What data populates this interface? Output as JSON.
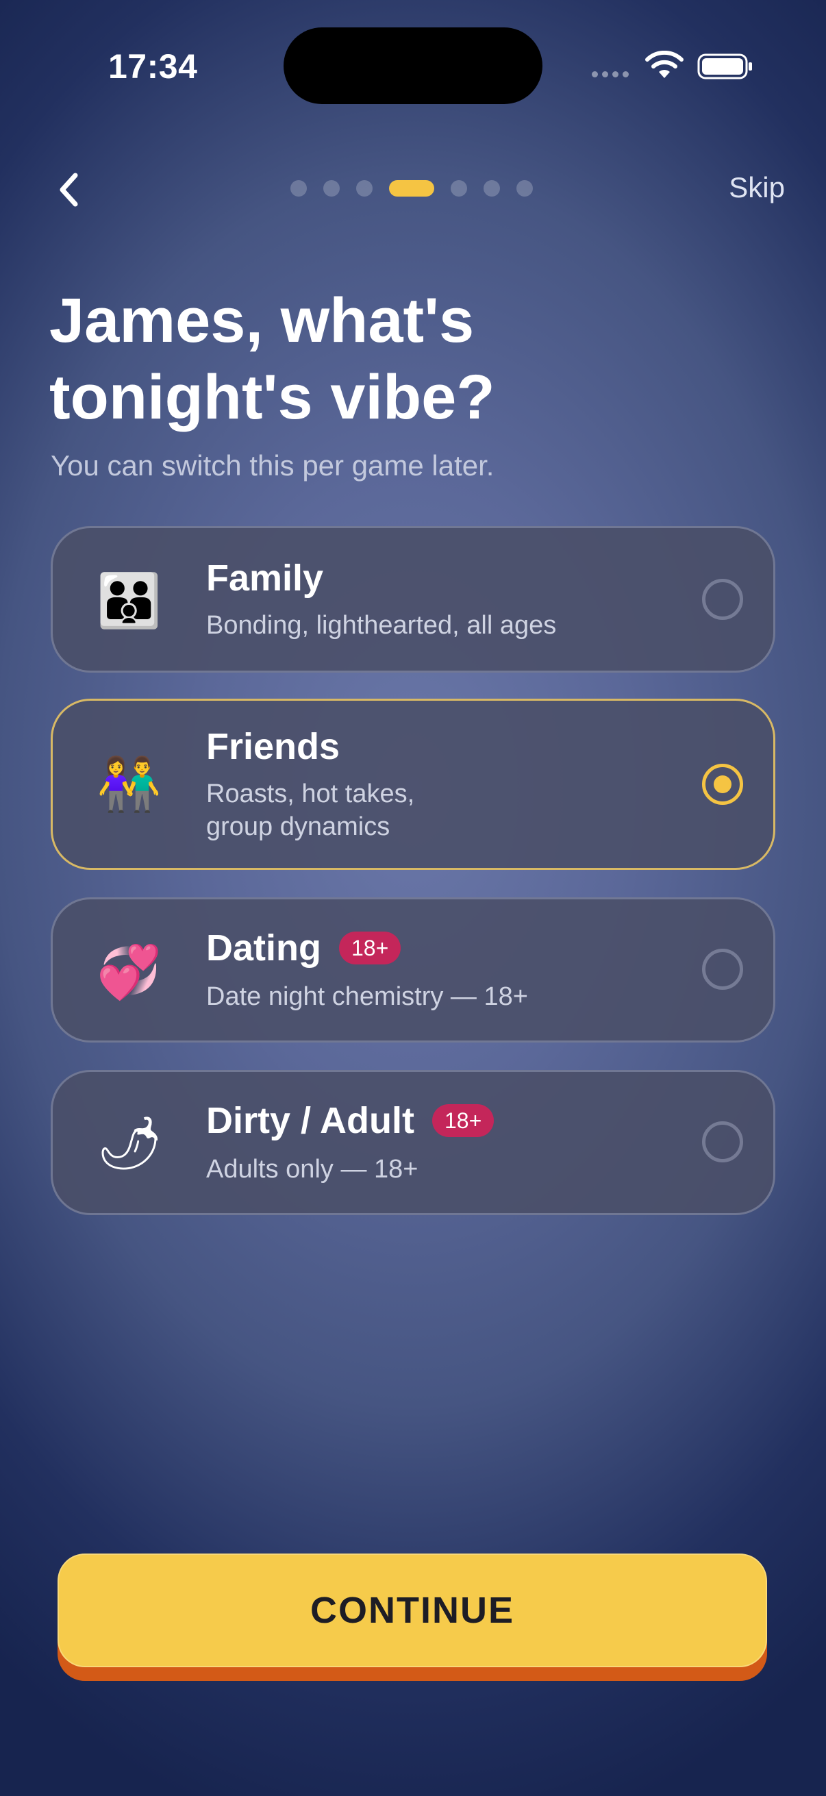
{
  "status_bar": {
    "time": "17:34"
  },
  "nav": {
    "skip_label": "Skip",
    "progress": {
      "total": 7,
      "current": 4
    }
  },
  "header": {
    "title_line1": "James, what's",
    "title_line2": "tonight's vibe?",
    "subtitle": "You can switch this per game later."
  },
  "options": [
    {
      "emoji": "👪",
      "name": "Family",
      "badge": "",
      "desc_line1": "Bonding, lighthearted, all ages",
      "desc_line2": "",
      "selected": false
    },
    {
      "emoji": "👫",
      "name": "Friends",
      "badge": "",
      "desc_line1": "Roasts, hot takes,",
      "desc_line2": "group dynamics",
      "selected": true
    },
    {
      "emoji": "💞",
      "name": "Dating",
      "badge": "18+",
      "desc_line1": "Date night chemistry — 18+",
      "desc_line2": "",
      "selected": false
    },
    {
      "emoji": "🌶",
      "name": "Dirty / Adult",
      "badge": "18+",
      "desc_line1": "Adults only — 18+",
      "desc_line2": "",
      "selected": false
    }
  ],
  "continue_label": "CONTINUE",
  "colors": {
    "accent": "#f5c443",
    "badge": "#c4265a",
    "button_shadow": "#d35a17"
  }
}
